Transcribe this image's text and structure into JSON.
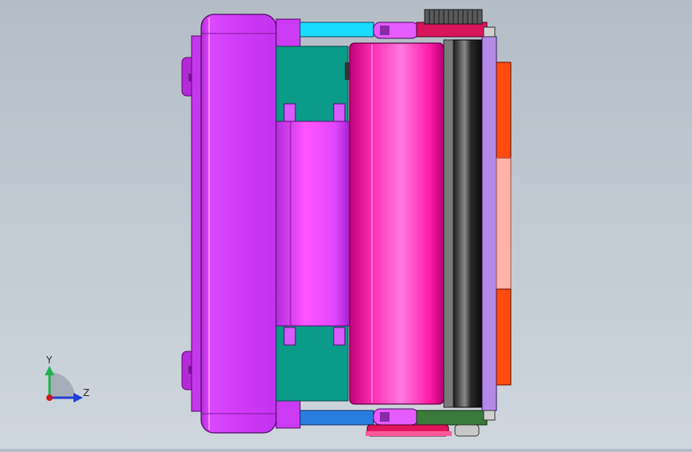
{
  "viewport": {
    "background_top": "#b4bdc6",
    "background_bottom": "#cfd6dd"
  },
  "triad": {
    "y_label": "Y",
    "z_label": "Z",
    "y_color": "#22b14c",
    "z_color": "#1f3fd6",
    "x_color": "#d01818"
  },
  "model": {
    "main_body_color": "#d43cff",
    "roller_color": "#ff1aa6",
    "side_panel_color": "#0a9b8a",
    "right_plate_top_color": "#ff5a10",
    "right_plate_mid_color": "#ffb0a8",
    "cyan_bar_color": "#19dcff",
    "blue_bar_color": "#2a7de0",
    "gear_color": "#555555"
  }
}
